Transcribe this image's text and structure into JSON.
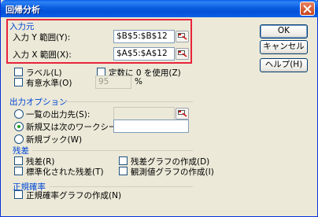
{
  "window": {
    "title": "回帰分析"
  },
  "input_group": {
    "label": "入力元",
    "y_range": {
      "label": "入力 Y 範囲(Y):",
      "value": "$B$5:$B$12"
    },
    "x_range": {
      "label": "入力 X 範囲(X):",
      "value": "$A$5:$A$12"
    },
    "labels_checkbox": "ラベル(L)",
    "constant_zero_checkbox": "定数に 0 を使用(Z)",
    "confidence_checkbox": "有意水準(O)",
    "confidence_value": "95",
    "confidence_unit": "%"
  },
  "output_group": {
    "label": "出力オプション",
    "output_range_radio": "一覧の出力先(S):",
    "new_sheet_radio": "新規又は次のワークシート(P):",
    "new_book_radio": "新規ブック(W)"
  },
  "residuals_group": {
    "label": "残差",
    "residuals": "残差(R)",
    "standardized_residuals": "標準化された残差(T)",
    "residual_plots": "残差グラフの作成(D)",
    "line_fit_plots": "観測値グラフの作成(I)"
  },
  "normal_group": {
    "label": "正規確率",
    "normal_probability_plots": "正規確率グラフの作成(N)"
  },
  "buttons": {
    "ok": "OK",
    "cancel": "キャンセル",
    "help": "ヘルプ(H)"
  },
  "colors": {
    "highlight": "#e8243a",
    "title_bar": "#0a5de0",
    "group_label": "#0046d5"
  }
}
